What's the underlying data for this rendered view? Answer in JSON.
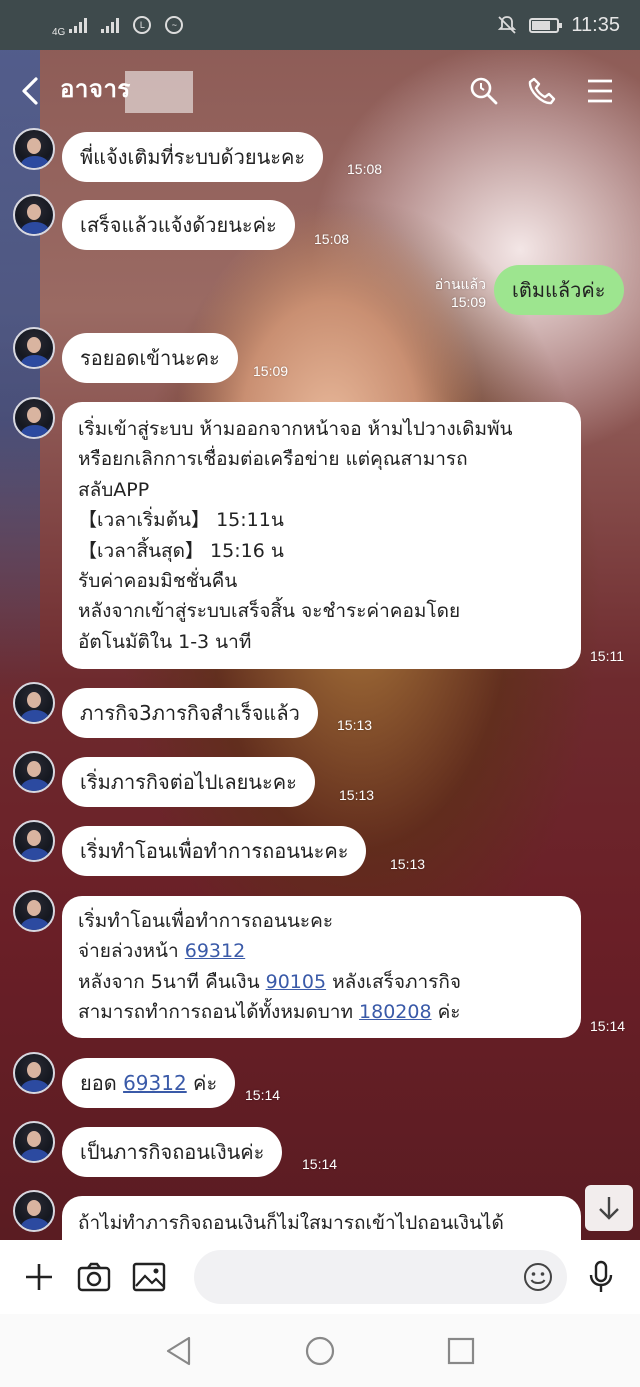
{
  "status_bar": {
    "network_left": "4G",
    "time": "11:35",
    "icons": [
      "signal-icon",
      "signal-icon",
      "line-app-icon",
      "messenger-icon",
      "mute-icon",
      "battery-icon"
    ]
  },
  "header": {
    "title": "อาจาร",
    "icons": [
      "back-arrow-icon",
      "search-icon",
      "phone-icon",
      "menu-icon"
    ]
  },
  "messages": [
    {
      "from": "other",
      "lines": [
        "พี่แจ้งเติมที่ระบบด้วยนะคะ"
      ],
      "time": "15:08"
    },
    {
      "from": "other",
      "lines": [
        "เสร็จแล้วแจ้งด้วยนะค่ะ"
      ],
      "time": "15:08"
    },
    {
      "from": "me",
      "lines": [
        "เติมแล้วค่ะ"
      ],
      "read": "อ่านแล้ว",
      "time": "15:09"
    },
    {
      "from": "other",
      "lines": [
        "รอยอดเข้านะคะ"
      ],
      "time": "15:09"
    },
    {
      "from": "other",
      "lines": [
        "เริ่มเข้าสู่ระบบ ห้ามออกจากหน้าจอ ห้ามไปวางเดิมพัน",
        "หรือยกเลิกการเชื่อมต่อเครือข่าย  แต่คุณสามารถ",
        "สลับAPP",
        "【เวลาเริ่มต้น】 15:11น",
        "【เวลาสิ้นสุด】 15:16 น",
        "รับค่าคอมมิชชั่นคืน",
        "หลังจากเข้าสู่ระบบเสร็จสิ้น จะชำระค่าคอมโดย",
        "อัตโนมัติใน 1-3 นาที"
      ],
      "time": "15:11"
    },
    {
      "from": "other",
      "lines": [
        "ภารกิจ3ภารกิจสำเร็จแล้ว"
      ],
      "time": "15:13"
    },
    {
      "from": "other",
      "lines": [
        "เริ่มภารกิจต่อไปเลยนะคะ"
      ],
      "time": "15:13"
    },
    {
      "from": "other",
      "lines": [
        "เริ่มทำโอนเพื่อทำการถอนนะคะ"
      ],
      "time": "15:13"
    },
    {
      "from": "other",
      "rich": [
        {
          "pre": "เริ่มทำโอนเพื่อทำการถอนนะคะ"
        },
        {
          "pre": "จ่ายล่วงหน้า ",
          "link": "69312"
        },
        {
          "pre": "หลังจาก 5นาที คืนเงิน ",
          "link": "90105",
          "post": " หลังเสร็จภารกิจ"
        },
        {
          "pre": "สามารถทำการถอนได้ทั้งหมดบาท ",
          "link": "180208",
          "post": " ค่ะ"
        }
      ],
      "time": "15:14"
    },
    {
      "from": "other",
      "rich": [
        {
          "pre": "ยอด ",
          "link": "69312",
          "post": " ค่ะ"
        }
      ],
      "time": "15:14"
    },
    {
      "from": "other",
      "lines": [
        "เป็นภารกิจถอนเงินค่ะ"
      ],
      "time": "15:14"
    },
    {
      "from": "other",
      "lines": [
        "ถ้าไม่ทำภารกิจถอนเงินก็ไม่ใสมารถเข้าไปถอนเงินได้"
      ],
      "time": ""
    }
  ],
  "input_bar": {
    "placeholder": "",
    "icons": [
      "plus-icon",
      "camera-icon",
      "image-icon",
      "emoji-icon",
      "microphone-icon"
    ]
  },
  "nav_bar": {
    "icons": [
      "nav-back-icon",
      "nav-home-icon",
      "nav-recents-icon"
    ]
  },
  "colors": {
    "my_bubble": "#9de58f",
    "other_bubble": "#ffffff",
    "link": "#3a5aa8",
    "status_bar": "#3e4a4c"
  }
}
